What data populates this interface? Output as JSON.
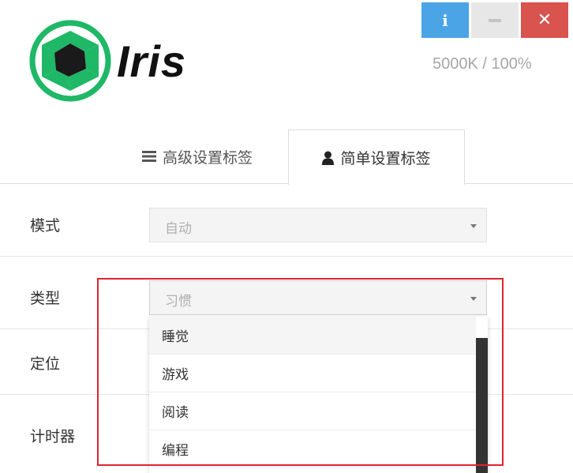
{
  "window": {
    "info_label": "i",
    "close_label": "✕",
    "status": "5000K / 100%"
  },
  "brand": {
    "name": "Iris"
  },
  "tabs": [
    {
      "label": "高级设置标签",
      "icon": "menu-icon",
      "active": false
    },
    {
      "label": "简单设置标签",
      "icon": "user-icon",
      "active": true
    }
  ],
  "form": {
    "mode": {
      "label": "模式",
      "value": "自动"
    },
    "type": {
      "label": "类型",
      "value": "习惯"
    },
    "location": {
      "label": "定位"
    },
    "timer": {
      "label": "计时器"
    }
  },
  "dropdown": {
    "items": [
      "睡觉",
      "游戏",
      "阅读",
      "编程"
    ],
    "hovered_index": 0
  },
  "colors": {
    "info": "#4ba4e6",
    "close": "#d9534f",
    "logo_green": "#1fb866",
    "highlight": "#e0232f"
  }
}
